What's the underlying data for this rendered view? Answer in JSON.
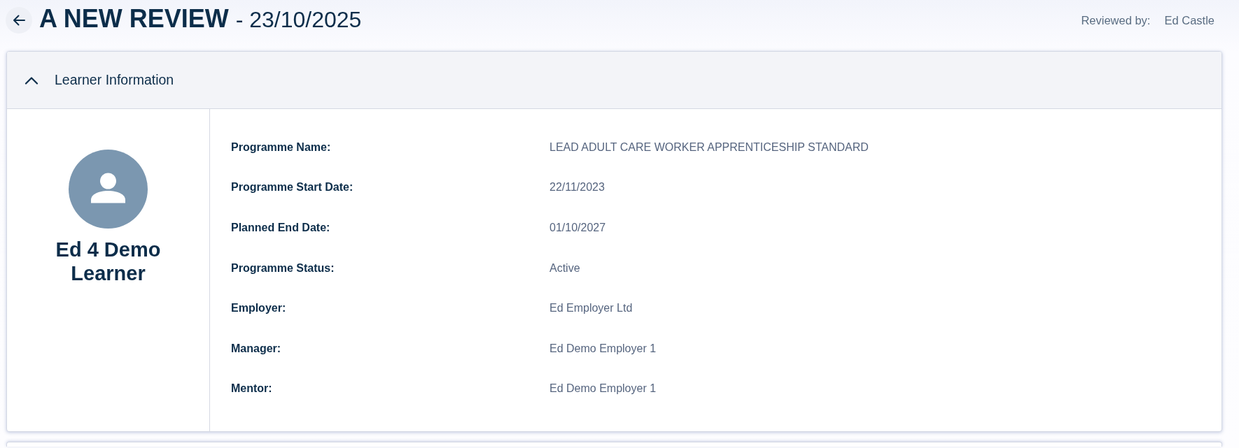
{
  "header": {
    "title": "A NEW REVIEW",
    "date": "- 23/10/2025",
    "reviewed_by_label": "Reviewed by:",
    "reviewer": "Ed Castle"
  },
  "panel": {
    "title": "Learner Information",
    "expanded": true,
    "learner_name": "Ed 4 Demo Learner",
    "fields": [
      {
        "label": "Programme Name:",
        "value": "LEAD ADULT CARE WORKER APPRENTICESHIP STANDARD"
      },
      {
        "label": "Programme Start Date:",
        "value": "22/11/2023"
      },
      {
        "label": "Planned End Date:",
        "value": "01/10/2027"
      },
      {
        "label": "Programme Status:",
        "value": "Active"
      },
      {
        "label": "Employer:",
        "value": "Ed Employer Ltd"
      },
      {
        "label": "Manager:",
        "value": "Ed Demo Employer 1"
      },
      {
        "label": "Mentor:",
        "value": "Ed Demo Employer 1"
      }
    ]
  }
}
